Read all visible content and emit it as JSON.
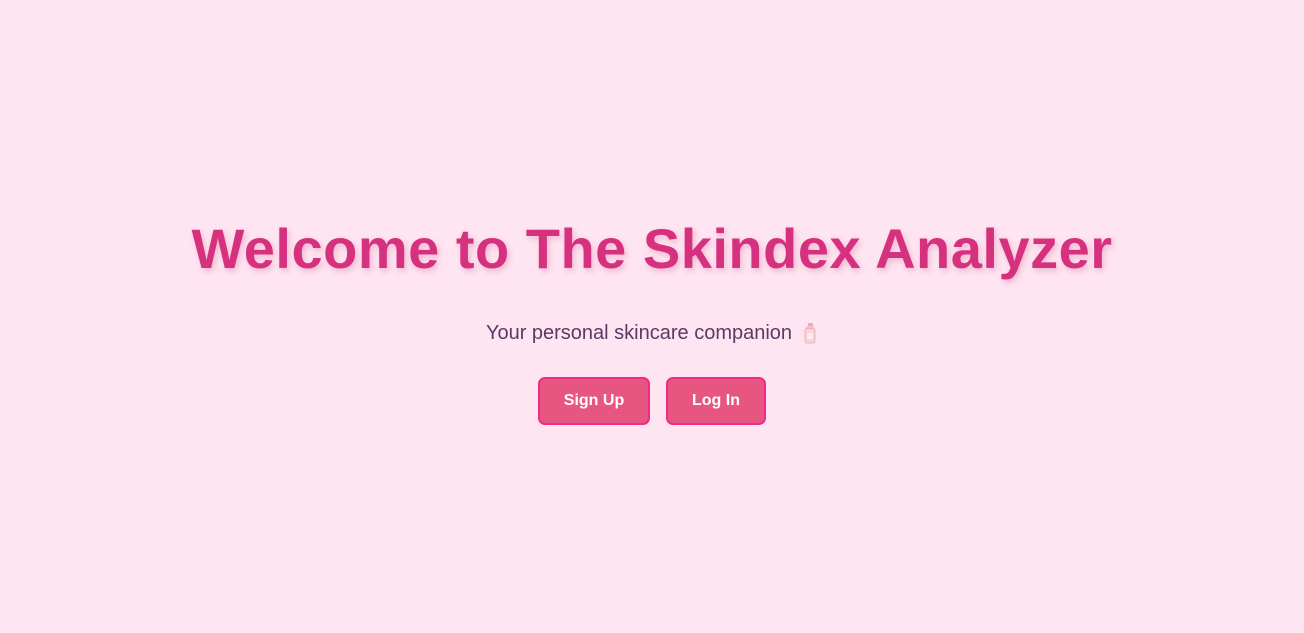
{
  "hero": {
    "title": "Welcome to The Skindex Analyzer",
    "subtitle": "Your personal skincare companion",
    "subtitle_icon": "lotion-bottle-icon"
  },
  "actions": {
    "signup_label": "Sign Up",
    "login_label": "Log In"
  },
  "colors": {
    "background": "#ffe4f1",
    "title": "#d6317f",
    "button_fill": "#e75680",
    "button_border": "#f02a86",
    "subtitle": "#5b3a66"
  }
}
